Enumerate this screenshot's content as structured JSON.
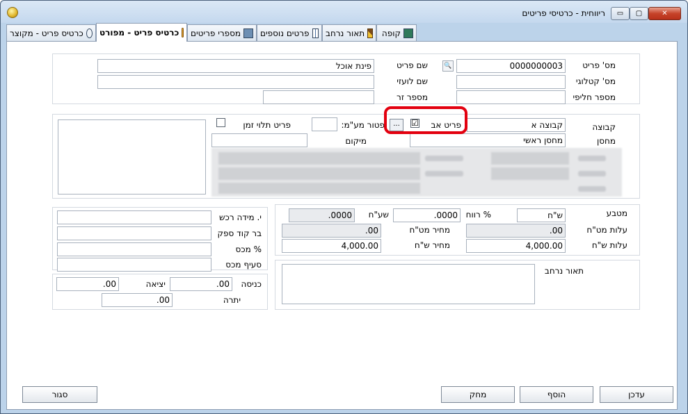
{
  "window": {
    "title": "ריווחית - כרטיסי פריטים",
    "min_symbol": "▭",
    "max_symbol": "▢",
    "close_symbol": "✕"
  },
  "tabs": [
    {
      "label": "קופה",
      "icon": "calculator-icon"
    },
    {
      "label": "תאור נרחב",
      "icon": "pen-icon"
    },
    {
      "label": "פרטים נוספים",
      "icon": "grid-icon"
    },
    {
      "label": "מספרי פריטים",
      "icon": "keyboard-icon"
    },
    {
      "label": "כרטיס פריט - מפורט",
      "icon": "person-icon",
      "active": true
    },
    {
      "label": "כרטיס פריט - מקוצר",
      "icon": "document-icon"
    }
  ],
  "ident": {
    "item_no_label": "מס' פריט",
    "item_no_value": "0000000003",
    "search_symbol": "🔍",
    "catalog_label": "מס' קטלוגי",
    "catalog_value": "",
    "alt_no_label": "מספר חליפי",
    "alt_no_value": "",
    "name_label": "שם פריט",
    "name_value": "פינת אוכל",
    "foreign_name_label": "שם לועזי",
    "foreign_name_value": "",
    "foreign_no_label": "מספר זר",
    "foreign_no_value": ""
  },
  "group": {
    "group_label": "קבוצה",
    "group_value": "קבוצה א",
    "warehouse_label": "מחסן",
    "warehouse_value": "מחסן ראשי",
    "parent_item_label": "פריט אב",
    "parent_item_check": "☑",
    "dots_label": "...",
    "vat_exempt_label": "פטור מע\"מ:",
    "vat_exempt_value": "",
    "time_dependent_label": "פריט תלוי זמן",
    "location_label": "מיקום",
    "location_value": ""
  },
  "pricing": {
    "currency_label": "מטבע",
    "currency_value": "ש\"ח",
    "profit_label": "% רווח",
    "profit_value": ".0000",
    "rate_label": "שע\"ח",
    "rate_value": ".0000",
    "cost_fx_label": "עלות מט\"ח",
    "cost_fx_value": ".00",
    "price_fx_label": "מחיר מט\"ח",
    "price_fx_value": ".00",
    "cost_ils_label": "עלות ש\"ח",
    "cost_ils_value": "4,000.00",
    "price_ils_label": "מחיר ש\"ח",
    "price_ils_value": "4,000.00"
  },
  "purchase": {
    "unit_label": "י. מידה רכש",
    "unit_value": "",
    "supplier_code_label": "בר קוד ספק",
    "supplier_code_value": "",
    "tax_pct_label": "% מכס",
    "tax_pct_value": "",
    "tax_clause_label": "סעיף מכס",
    "tax_clause_value": ""
  },
  "stock": {
    "in_label": "כניסה",
    "in_value": ".00",
    "out_label": "יציאה",
    "out_value": ".00",
    "balance_label": "יתרה",
    "balance_value": ".00"
  },
  "extended": {
    "label": "תאור נרחב",
    "value": ""
  },
  "buttons": {
    "update": "עדכן",
    "add": "הוסף",
    "delete": "מחק",
    "close": "סגור"
  }
}
